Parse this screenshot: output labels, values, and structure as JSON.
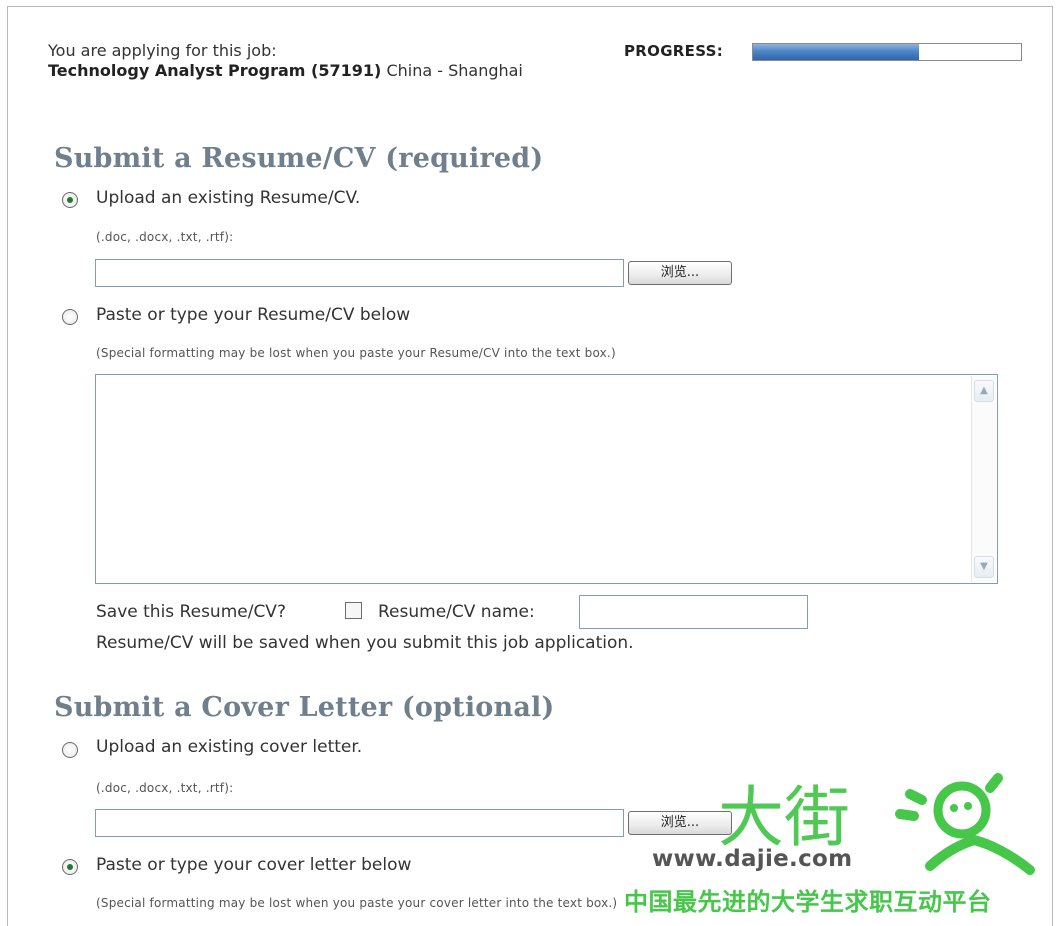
{
  "job": {
    "intro": "You are applying for this job:",
    "title": "Technology Analyst Program (57191)",
    "location": "China - Shanghai"
  },
  "progress": {
    "label": "PROGRESS:",
    "fraction": 0.62
  },
  "resume": {
    "heading": "Submit a Resume/CV (required)",
    "upload_option": {
      "label": "Upload an existing Resume/CV.",
      "selected": true
    },
    "file_types": "(.doc, .docx, .txt, .rtf):",
    "file_value": "",
    "browse_label": "浏览...",
    "paste_option": {
      "label": "Paste or type your Resume/CV below",
      "selected": false
    },
    "paste_hint": "(Special formatting may be lost when you paste your Resume/CV into the text box.)",
    "textarea_value": "",
    "save_label": "Save this Resume/CV?",
    "save_checked": false,
    "name_label": "Resume/CV name:",
    "name_value": "",
    "save_note": "Resume/CV will be saved when you submit this job application."
  },
  "cover": {
    "heading": "Submit a Cover Letter (optional)",
    "upload_option": {
      "label": "Upload an existing cover letter.",
      "selected": false
    },
    "file_types": "(.doc, .docx, .txt, .rtf):",
    "file_value": "",
    "browse_label": "浏览...",
    "paste_option": {
      "label": "Paste or type your cover letter below",
      "selected": true
    },
    "paste_hint": "(Special formatting may be lost when you paste your cover letter into the text box.)"
  },
  "watermark": {
    "cn_big": "大街",
    "url": "www.dajie.com",
    "slogan": "中国最先进的大学生求职互动平台",
    "mascot_icon": "running-figure-logo",
    "color": "#46c74a"
  },
  "icons": {
    "scroll_up": "scroll-up-arrow",
    "scroll_down": "scroll-down-arrow"
  }
}
